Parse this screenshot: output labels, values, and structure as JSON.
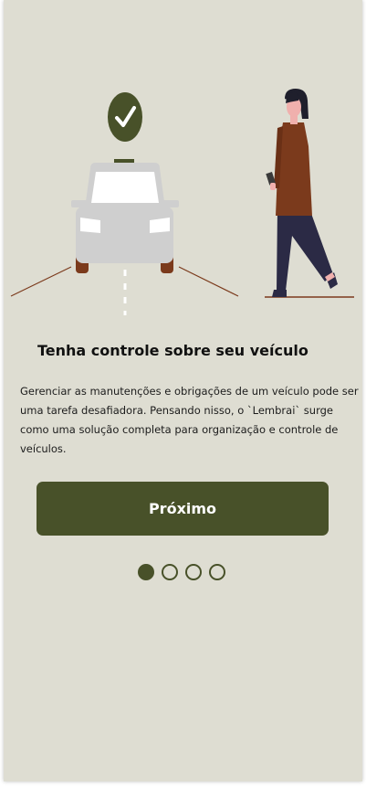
{
  "colors": {
    "background": "#deddd2",
    "accent": "#485129",
    "car_body": "#cfcfcf",
    "coat": "#7b3a1c",
    "pants": "#2b2a45"
  },
  "illustration": {
    "badge_icon": "check-icon",
    "subject": "car-icon",
    "figure": "person-icon"
  },
  "onboarding": {
    "title": "Tenha controle sobre seu veículo",
    "description": "Gerenciar as manutenções e obrigações de um veículo pode ser uma tarefa desafiadora. Pensando nisso, o `Lembrai` surge como uma solução completa para organização e controle de veículos.",
    "next_label": "Próximo"
  },
  "pagination": {
    "total": 4,
    "current": 1
  }
}
